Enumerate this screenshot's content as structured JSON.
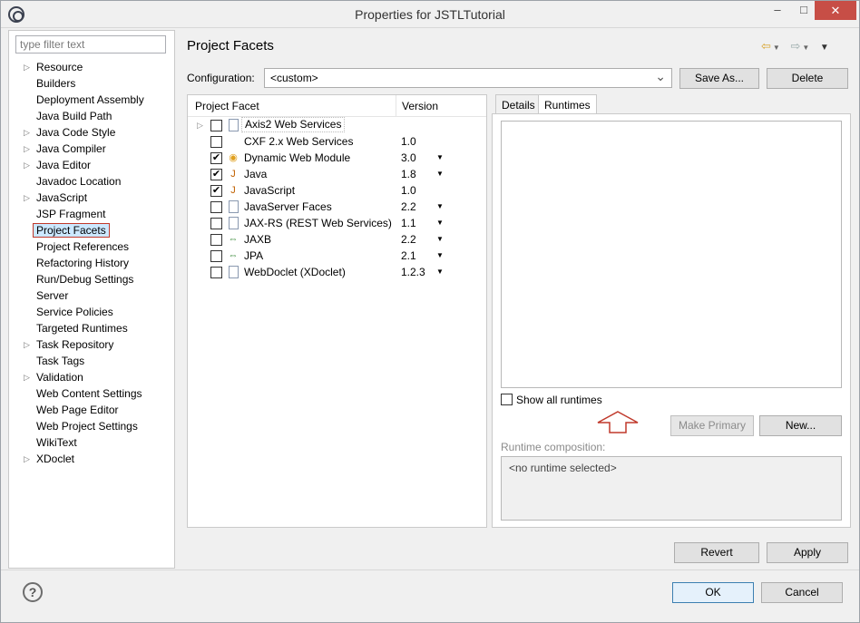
{
  "window": {
    "title": "Properties for JSTLTutorial",
    "minimize_glyph": "–",
    "maximize_glyph": "□",
    "close_glyph": "✕"
  },
  "filter": {
    "placeholder": "type filter text"
  },
  "tree": {
    "items": [
      {
        "label": "Resource",
        "expandable": true
      },
      {
        "label": "Builders",
        "expandable": false
      },
      {
        "label": "Deployment Assembly",
        "expandable": false
      },
      {
        "label": "Java Build Path",
        "expandable": false
      },
      {
        "label": "Java Code Style",
        "expandable": true
      },
      {
        "label": "Java Compiler",
        "expandable": true
      },
      {
        "label": "Java Editor",
        "expandable": true
      },
      {
        "label": "Javadoc Location",
        "expandable": false
      },
      {
        "label": "JavaScript",
        "expandable": true
      },
      {
        "label": "JSP Fragment",
        "expandable": false
      },
      {
        "label": "Project Facets",
        "expandable": false,
        "selected": true
      },
      {
        "label": "Project References",
        "expandable": false
      },
      {
        "label": "Refactoring History",
        "expandable": false
      },
      {
        "label": "Run/Debug Settings",
        "expandable": false
      },
      {
        "label": "Server",
        "expandable": false
      },
      {
        "label": "Service Policies",
        "expandable": false
      },
      {
        "label": "Targeted Runtimes",
        "expandable": false
      },
      {
        "label": "Task Repository",
        "expandable": true
      },
      {
        "label": "Task Tags",
        "expandable": false
      },
      {
        "label": "Validation",
        "expandable": true
      },
      {
        "label": "Web Content Settings",
        "expandable": false
      },
      {
        "label": "Web Page Editor",
        "expandable": false
      },
      {
        "label": "Web Project Settings",
        "expandable": false
      },
      {
        "label": "WikiText",
        "expandable": false
      },
      {
        "label": "XDoclet",
        "expandable": true
      }
    ]
  },
  "main": {
    "title": "Project Facets",
    "configuration_label": "Configuration:",
    "configuration_value": "<custom>",
    "save_as_label": "Save As...",
    "delete_label": "Delete"
  },
  "facets": {
    "columns": [
      "Project Facet",
      "Version"
    ],
    "rows": [
      {
        "name": "Axis2 Web Services",
        "version": "",
        "checked": false,
        "icon": "document-icon",
        "expandable": true,
        "dropdown": false
      },
      {
        "name": "CXF 2.x Web Services",
        "version": "1.0",
        "checked": false,
        "icon": "none",
        "expandable": false,
        "dropdown": false
      },
      {
        "name": "Dynamic Web Module",
        "version": "3.0",
        "checked": true,
        "icon": "globe-icon",
        "expandable": false,
        "dropdown": true
      },
      {
        "name": "Java",
        "version": "1.8",
        "checked": true,
        "icon": "jar-icon",
        "expandable": false,
        "dropdown": true
      },
      {
        "name": "JavaScript",
        "version": "1.0",
        "checked": true,
        "icon": "jar-icon",
        "expandable": false,
        "dropdown": false
      },
      {
        "name": "JavaServer Faces",
        "version": "2.2",
        "checked": false,
        "icon": "document-icon",
        "expandable": false,
        "dropdown": true
      },
      {
        "name": "JAX-RS (REST Web Services)",
        "version": "1.1",
        "checked": false,
        "icon": "document-icon",
        "expandable": false,
        "dropdown": true
      },
      {
        "name": "JAXB",
        "version": "2.2",
        "checked": false,
        "icon": "swap-icon",
        "expandable": false,
        "dropdown": true
      },
      {
        "name": "JPA",
        "version": "2.1",
        "checked": false,
        "icon": "swap-icon",
        "expandable": false,
        "dropdown": true
      },
      {
        "name": "WebDoclet (XDoclet)",
        "version": "1.2.3",
        "checked": false,
        "icon": "document-icon",
        "expandable": false,
        "dropdown": true
      }
    ]
  },
  "tabs": [
    {
      "label": "Details",
      "active": false
    },
    {
      "label": "Runtimes",
      "active": true
    }
  ],
  "runtimes": {
    "show_all_label": "Show all runtimes",
    "make_primary_label": "Make Primary",
    "new_label": "New...",
    "composition_label": "Runtime composition:",
    "composition_value": "<no runtime selected>"
  },
  "footer": {
    "revert_label": "Revert",
    "apply_label": "Apply",
    "ok_label": "OK",
    "cancel_label": "Cancel",
    "help_glyph": "?"
  },
  "colors": {
    "selection_bg": "#cce8ff",
    "selection_border": "#c0392b",
    "close_button": "#c74e46",
    "annotation_arrow": "#c0392b"
  }
}
